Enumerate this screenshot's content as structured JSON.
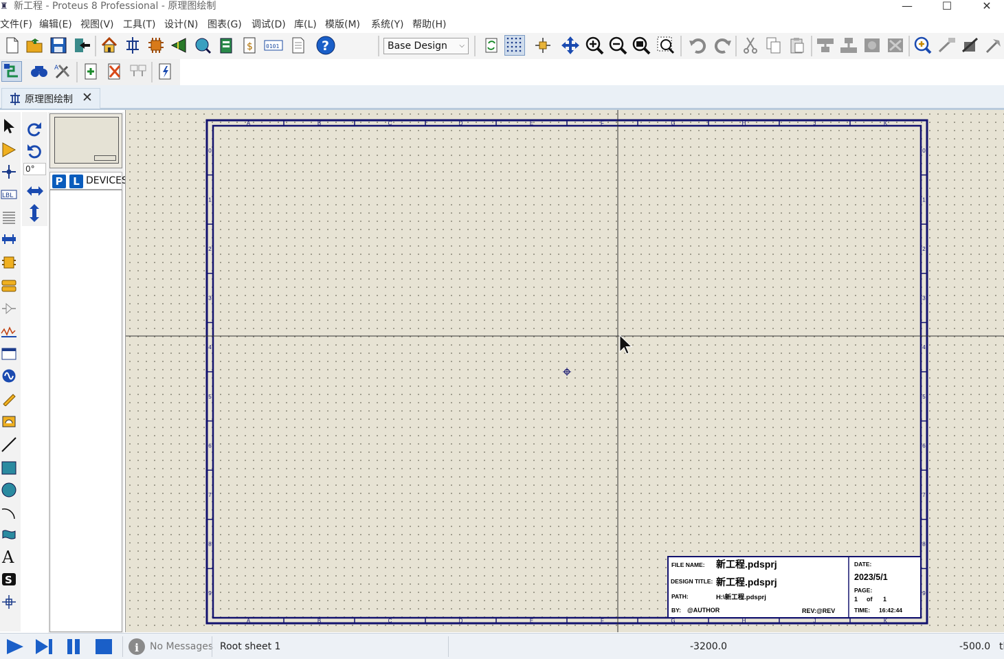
{
  "window": {
    "title": "新工程 - Proteus 8 Professional - 原理图绘制",
    "minimize": "—",
    "maximize": "☐",
    "close": "✕"
  },
  "menu": [
    "文件(F)",
    "编辑(E)",
    "视图(V)",
    "工具(T)",
    "设计(N)",
    "图表(G)",
    "调试(D)",
    "库(L)",
    "模版(M)",
    "系统(Y)",
    "帮助(H)"
  ],
  "toolbar": {
    "design_selector": "Base Design"
  },
  "tabs": [
    {
      "label": "原理图绘制",
      "close": "✕"
    }
  ],
  "rotation": {
    "angle": "0°"
  },
  "device_panel": {
    "p_button": "P",
    "l_button": "L",
    "label": "DEVICES"
  },
  "sheet": {
    "columns": [
      "A",
      "B",
      "C",
      "D",
      "E",
      "F",
      "G",
      "H",
      "J",
      "K"
    ],
    "rows": [
      "0",
      "1",
      "2",
      "3",
      "4",
      "5",
      "6",
      "7",
      "8",
      "9"
    ],
    "title_block": {
      "file_name_label": "FILE NAME:",
      "file_name": "新工程.pdsprj",
      "design_title_label": "DESIGN TITLE:",
      "design_title": "新工程.pdsprj",
      "path_label": "PATH:",
      "path": "H:\\新工程.pdsprj",
      "by_label": "BY:",
      "author": "@AUTHOR",
      "rev": "REV:@REV",
      "date_label": "DATE:",
      "date": "2023/5/1",
      "page_label": "PAGE:",
      "page": "1",
      "of_label": "of",
      "page_total": "1",
      "time_label": "TIME:",
      "time": "16:42:44"
    }
  },
  "status": {
    "messages": "No Messages",
    "sheet": "Root sheet 1",
    "x": "-3200.0",
    "y": "-500.0",
    "unit": "th"
  }
}
